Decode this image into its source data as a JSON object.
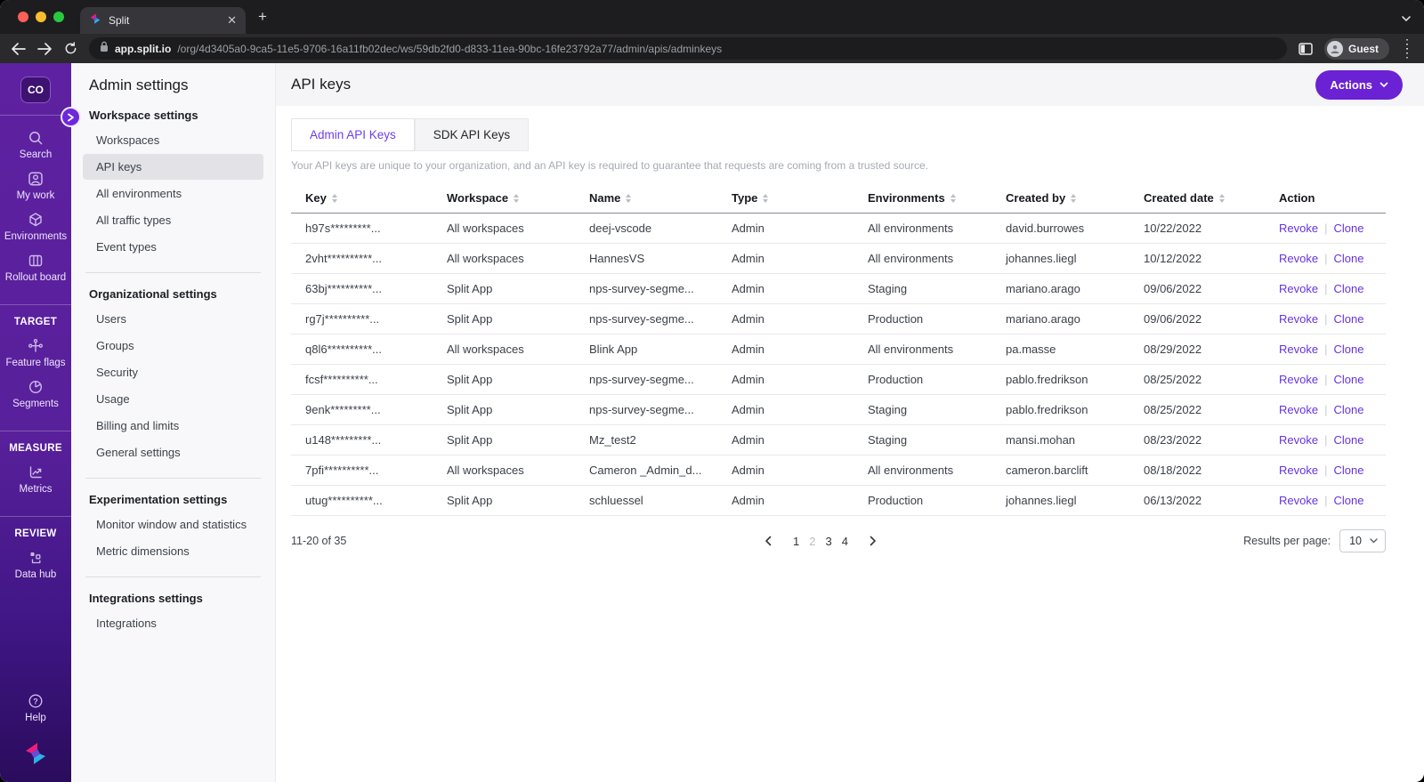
{
  "browser": {
    "tab_title": "Split",
    "url_domain": "app.split.io",
    "url_path": "/org/4d3405a0-9ca5-11e5-9706-16a11fb02dec/ws/59db2fd0-d833-11ea-90bc-16fe23792a77/admin/apis/adminkeys",
    "profile_label": "Guest"
  },
  "sidebar": {
    "org_badge": "CO",
    "search": "Search",
    "my_work": "My work",
    "environments": "Environments",
    "rollout_board": "Rollout board",
    "target_header": "TARGET",
    "feature_flags": "Feature flags",
    "segments": "Segments",
    "measure_header": "MEASURE",
    "metrics": "Metrics",
    "review_header": "REVIEW",
    "data_hub": "Data hub",
    "help": "Help"
  },
  "settings_nav": {
    "title": "Admin settings",
    "sections": [
      {
        "heading": "Workspace settings",
        "items": [
          {
            "label": "Workspaces"
          },
          {
            "label": "API keys",
            "active": true
          },
          {
            "label": "All environments"
          },
          {
            "label": "All traffic types"
          },
          {
            "label": "Event types"
          }
        ]
      },
      {
        "heading": "Organizational settings",
        "items": [
          {
            "label": "Users"
          },
          {
            "label": "Groups"
          },
          {
            "label": "Security"
          },
          {
            "label": "Usage"
          },
          {
            "label": "Billing and limits"
          },
          {
            "label": "General settings"
          }
        ]
      },
      {
        "heading": "Experimentation settings",
        "items": [
          {
            "label": "Monitor window and statistics"
          },
          {
            "label": "Metric dimensions"
          }
        ]
      },
      {
        "heading": "Integrations settings",
        "items": [
          {
            "label": "Integrations"
          }
        ]
      }
    ]
  },
  "main": {
    "title": "API keys",
    "actions_button": "Actions",
    "tabs": [
      {
        "label": "Admin API Keys",
        "active": true
      },
      {
        "label": "SDK API Keys"
      }
    ],
    "description": "Your API keys are unique to your organization, and an API key is required to guarantee that requests are coming from a trusted source.",
    "table": {
      "columns": [
        {
          "label": "Key"
        },
        {
          "label": "Workspace"
        },
        {
          "label": "Name"
        },
        {
          "label": "Type"
        },
        {
          "label": "Environments"
        },
        {
          "label": "Created by"
        },
        {
          "label": "Created date"
        },
        {
          "label": "Action",
          "sortable": false
        }
      ],
      "action_revoke": "Revoke",
      "action_clone": "Clone",
      "rows": [
        {
          "key": "h97s*********...",
          "workspace": "All workspaces",
          "name": "deej-vscode",
          "type": "Admin",
          "environments": "All environments",
          "created_by": "david.burrowes",
          "created_date": "10/22/2022"
        },
        {
          "key": "2vht**********...",
          "workspace": "All workspaces",
          "name": "HannesVS",
          "type": "Admin",
          "environments": "All environments",
          "created_by": "johannes.liegl",
          "created_date": "10/12/2022"
        },
        {
          "key": "63bj**********...",
          "workspace": "Split App",
          "name": "nps-survey-segme...",
          "type": "Admin",
          "environments": "Staging",
          "created_by": "mariano.arago",
          "created_date": "09/06/2022"
        },
        {
          "key": "rg7j**********...",
          "workspace": "Split App",
          "name": "nps-survey-segme...",
          "type": "Admin",
          "environments": "Production",
          "created_by": "mariano.arago",
          "created_date": "09/06/2022"
        },
        {
          "key": "q8l6**********...",
          "workspace": "All workspaces",
          "name": "Blink App",
          "type": "Admin",
          "environments": "All environments",
          "created_by": "pa.masse",
          "created_date": "08/29/2022"
        },
        {
          "key": "fcsf**********...",
          "workspace": "Split App",
          "name": "nps-survey-segme...",
          "type": "Admin",
          "environments": "Production",
          "created_by": "pablo.fredrikson",
          "created_date": "08/25/2022"
        },
        {
          "key": "9enk*********...",
          "workspace": "Split App",
          "name": "nps-survey-segme...",
          "type": "Admin",
          "environments": "Staging",
          "created_by": "pablo.fredrikson",
          "created_date": "08/25/2022"
        },
        {
          "key": "u148*********...",
          "workspace": "Split App",
          "name": "Mz_test2",
          "type": "Admin",
          "environments": "Staging",
          "created_by": "mansi.mohan",
          "created_date": "08/23/2022"
        },
        {
          "key": "7pfi**********...",
          "workspace": "All workspaces",
          "name": "Cameron _Admin_d...",
          "type": "Admin",
          "environments": "All environments",
          "created_by": "cameron.barclift",
          "created_date": "08/18/2022"
        },
        {
          "key": "utug**********...",
          "workspace": "Split App",
          "name": "schluessel",
          "type": "Admin",
          "environments": "Production",
          "created_by": "johannes.liegl",
          "created_date": "06/13/2022"
        }
      ]
    },
    "pagination": {
      "range_label": "11-20 of 35",
      "pages": [
        {
          "label": "1"
        },
        {
          "label": "2",
          "current": true
        },
        {
          "label": "3"
        },
        {
          "label": "4"
        }
      ],
      "results_per_page_label": "Results per page:",
      "results_per_page_value": "10"
    }
  }
}
